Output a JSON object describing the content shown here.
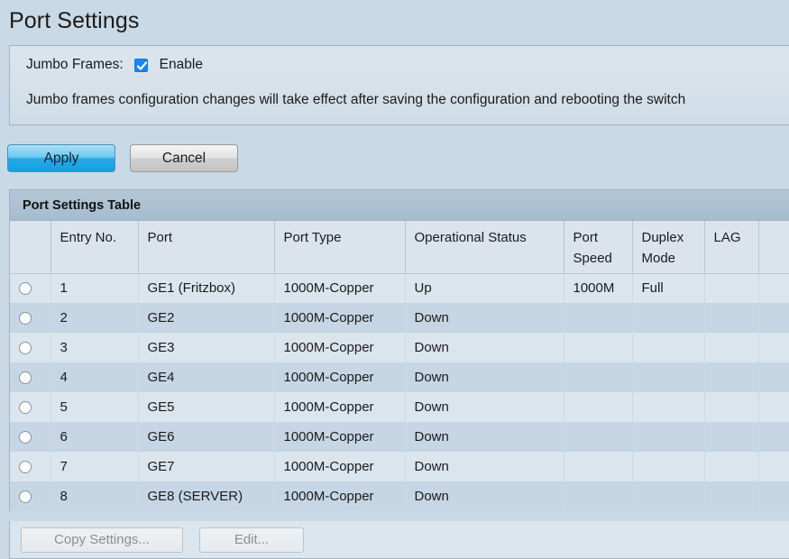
{
  "page": {
    "title": "Port Settings"
  },
  "jumbo": {
    "label": "Jumbo Frames:",
    "checkbox_checked": true,
    "enable_label": "Enable",
    "note": "Jumbo frames configuration changes will take effect after saving the configuration and rebooting the switch"
  },
  "actions": {
    "apply_label": "Apply",
    "cancel_label": "Cancel"
  },
  "table": {
    "caption": "Port Settings Table",
    "columns": [
      "",
      "Entry No.",
      "Port",
      "Port Type",
      "Operational Status",
      "Port Speed",
      "Duplex Mode",
      "LAG",
      ""
    ],
    "column_speed_line1": "Port",
    "column_speed_line2": "Speed",
    "column_duplex_line1": "Duplex",
    "column_duplex_line2": "Mode",
    "rows": [
      {
        "entry": "1",
        "port": "GE1 (Fritzbox)",
        "type": "1000M-Copper",
        "status": "Up",
        "speed": "1000M",
        "duplex": "Full",
        "lag": "",
        "selected": false
      },
      {
        "entry": "2",
        "port": "GE2",
        "type": "1000M-Copper",
        "status": "Down",
        "speed": "",
        "duplex": "",
        "lag": "",
        "selected": false
      },
      {
        "entry": "3",
        "port": "GE3",
        "type": "1000M-Copper",
        "status": "Down",
        "speed": "",
        "duplex": "",
        "lag": "",
        "selected": false
      },
      {
        "entry": "4",
        "port": "GE4",
        "type": "1000M-Copper",
        "status": "Down",
        "speed": "",
        "duplex": "",
        "lag": "",
        "selected": false
      },
      {
        "entry": "5",
        "port": "GE5",
        "type": "1000M-Copper",
        "status": "Down",
        "speed": "",
        "duplex": "",
        "lag": "",
        "selected": false
      },
      {
        "entry": "6",
        "port": "GE6",
        "type": "1000M-Copper",
        "status": "Down",
        "speed": "",
        "duplex": "",
        "lag": "",
        "selected": false
      },
      {
        "entry": "7",
        "port": "GE7",
        "type": "1000M-Copper",
        "status": "Down",
        "speed": "",
        "duplex": "",
        "lag": "",
        "selected": false
      },
      {
        "entry": "8",
        "port": "GE8 (SERVER)",
        "type": "1000M-Copper",
        "status": "Down",
        "speed": "",
        "duplex": "",
        "lag": "",
        "selected": false
      }
    ]
  },
  "footer": {
    "copy_settings_label": "Copy Settings...",
    "edit_label": "Edit...",
    "copy_settings_disabled": true,
    "edit_disabled": true
  },
  "colors": {
    "page_background": "#c9d9e5",
    "panel_background": "#dbe5ee",
    "table_caption_bar": "#a6bccf",
    "row_odd": "#dbe5ed",
    "row_even": "#c6d6e4",
    "accent_blue": "#1a84f0",
    "apply_button_blue": "#12a0e4",
    "border": "#9fb3c4"
  },
  "icons": {
    "checkbox": "check-icon",
    "radio": "radio-unselected-icon"
  }
}
